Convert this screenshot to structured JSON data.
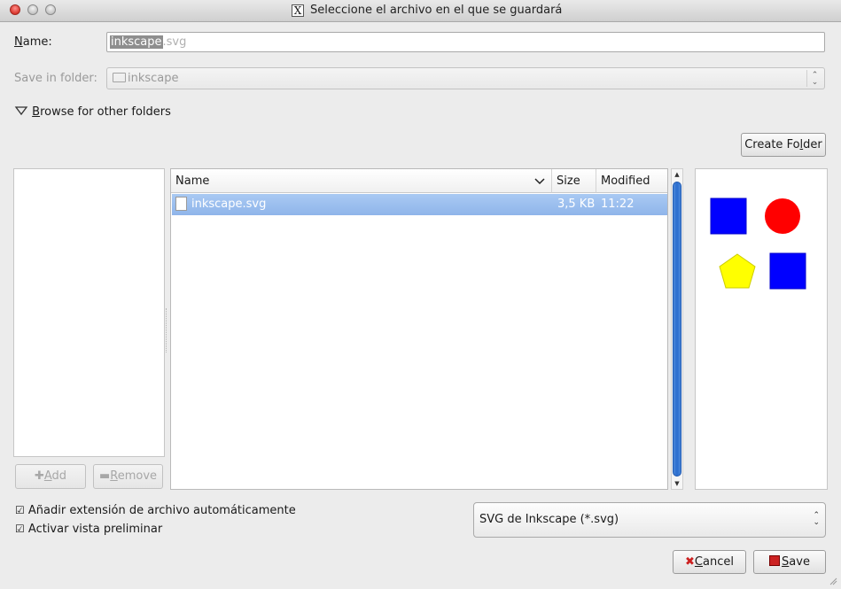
{
  "window": {
    "title": "Seleccione el archivo en el que se guardará",
    "x_icon": "X"
  },
  "name_field": {
    "label_prefix": "N",
    "label_rest": "ame:",
    "selected_text": "inkscape",
    "extension_text": ".svg"
  },
  "save_in": {
    "label": "Save in folder:",
    "value": "inkscape"
  },
  "browse": {
    "label_first": "B",
    "label_rest": "rowse for other folders"
  },
  "buttons": {
    "create_folder_a": "Create Fo",
    "create_folder_u": "l",
    "create_folder_b": "der",
    "add_u": "A",
    "add_rest": "dd",
    "remove_u": "R",
    "remove_rest": "emove",
    "cancel_u": "C",
    "cancel_rest": "ancel",
    "save_u": "S",
    "save_rest": "ave"
  },
  "file_list": {
    "columns": {
      "name": "Name",
      "size": "Size",
      "modified": "Modified"
    },
    "rows": [
      {
        "name": "inkscape.svg",
        "size": "3,5 KB",
        "modified": "11:22"
      }
    ]
  },
  "options": {
    "auto_extension": "Añadir extensión de archivo automáticamente",
    "auto_extension_checked": true,
    "preview": "Activar vista preliminar",
    "preview_checked": true,
    "checkmark": "☑"
  },
  "filter": {
    "value": "SVG de Inkscape (*.svg)"
  },
  "preview_shapes": {
    "colors": {
      "blue": "#0000ff",
      "red": "#ff0000",
      "yellow": "#ffff00"
    }
  }
}
